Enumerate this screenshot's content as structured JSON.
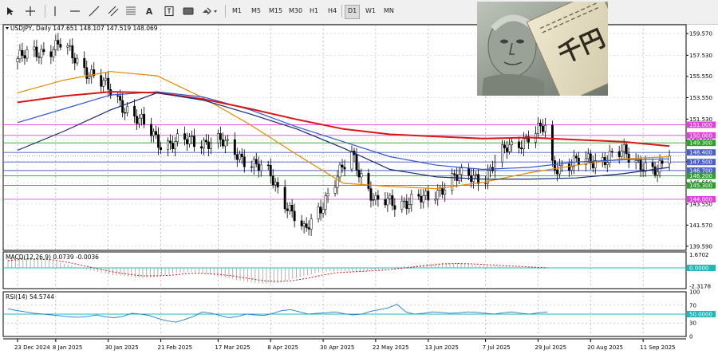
{
  "toolbar": {
    "tools": [
      "cursor-icon",
      "crosshair-icon",
      "vertical-line-icon",
      "horizontal-line-icon",
      "trendline-icon",
      "channel-icon",
      "fibonacci-icon",
      "text-icon",
      "label-icon",
      "rectangle-icon",
      "arrows-icon"
    ],
    "timeframes": [
      "M1",
      "M5",
      "M15",
      "M30",
      "H1",
      "H4",
      "D1",
      "W1",
      "MN"
    ],
    "active_timeframe": "D1"
  },
  "chart_data": [
    {
      "type": "candlestick",
      "title": "USDJPY, Daily  147.651 148.107 147.519 148.069",
      "symbol": "USDJPY",
      "period": "Daily",
      "last_ohlc": {
        "open": 147.651,
        "high": 148.107,
        "low": 147.519,
        "close": 148.069
      },
      "ylim": [
        139.2,
        160.4
      ],
      "y_ticks": [
        "159.570",
        "157.530",
        "155.550",
        "153.550",
        "151.530",
        "149.550",
        "147.550",
        "145.550",
        "143.550",
        "141.570",
        "139.590"
      ],
      "x_ticks": [
        "23 Dec 2024",
        "8 Jan 2025",
        "30 Jan 2025",
        "21 Feb 2025",
        "17 Mar 2025",
        "8 Apr 2025",
        "30 Apr 2025",
        "22 May 2025",
        "13 Jun 2025",
        "7 Jul 2025",
        "29 Jul 2025",
        "20 Aug 2025",
        "11 Sep 2025"
      ],
      "key_closes": [
        {
          "date": "2024-12-23",
          "close": 157.2
        },
        {
          "date": "2025-01-10",
          "close": 158.5
        },
        {
          "date": "2025-01-30",
          "close": 154.3
        },
        {
          "date": "2025-02-21",
          "close": 149.3
        },
        {
          "date": "2025-03-17",
          "close": 149.5
        },
        {
          "date": "2025-04-08",
          "close": 146.2
        },
        {
          "date": "2025-04-22",
          "close": 140.8
        },
        {
          "date": "2025-05-12",
          "close": 148.2
        },
        {
          "date": "2025-05-22",
          "close": 143.6
        },
        {
          "date": "2025-06-13",
          "close": 144.0
        },
        {
          "date": "2025-06-23",
          "close": 146.0
        },
        {
          "date": "2025-07-07",
          "close": 146.2
        },
        {
          "date": "2025-07-16",
          "close": 148.8
        },
        {
          "date": "2025-08-01",
          "close": 150.7
        },
        {
          "date": "2025-08-04",
          "close": 147.1
        },
        {
          "date": "2025-08-20",
          "close": 147.6
        },
        {
          "date": "2025-09-03",
          "close": 148.3
        },
        {
          "date": "2025-09-11",
          "close": 147.3
        },
        {
          "date": "2025-09-17",
          "close": 146.4
        },
        {
          "date": "2025-09-22",
          "close": 148.069
        }
      ],
      "moving_averages": [
        {
          "color": "#e08a00",
          "values": [
            154.0,
            155.2,
            156.0,
            155.6,
            153.5,
            151.0,
            148.2,
            145.5,
            145.2,
            145.0,
            145.6,
            146.5,
            147.2,
            147.8,
            148.0
          ]
        },
        {
          "color": "#3356cc",
          "values": [
            151.2,
            152.5,
            153.8,
            154.1,
            153.6,
            152.4,
            150.8,
            149.4,
            148.0,
            147.2,
            146.8,
            147.0,
            147.5,
            147.7,
            147.8
          ]
        },
        {
          "color": "#d81818",
          "values": [
            153.1,
            153.7,
            154.1,
            154.0,
            153.4,
            152.5,
            151.5,
            150.6,
            150.1,
            149.9,
            149.7,
            149.8,
            149.6,
            149.4,
            149.0
          ]
        },
        {
          "color": "#1a2a6e",
          "values": [
            148.6,
            150.4,
            152.4,
            154.0,
            153.3,
            152.0,
            150.6,
            148.8,
            146.8,
            146.1,
            145.9,
            145.9,
            146.0,
            146.4,
            147.0
          ]
        }
      ],
      "levels": [
        {
          "label": "151.000",
          "value": 151.0,
          "color": "#e040e0"
        },
        {
          "label": "150.000",
          "value": 150.0,
          "color": "#e040e0"
        },
        {
          "label": "149.300",
          "value": 149.3,
          "color": "#2e9e2e"
        },
        {
          "label": "148.400",
          "value": 148.4,
          "color": "#4a5fc8"
        },
        {
          "label": "147.500",
          "value": 147.5,
          "color": "#4a5fc8"
        },
        {
          "label": "146.700",
          "value": 146.7,
          "color": "#4a5fc8"
        },
        {
          "label": "146.200",
          "value": 146.2,
          "color": "#2e9e2e"
        },
        {
          "label": "145.300",
          "value": 145.3,
          "color": "#2e9e2e"
        },
        {
          "label": "144.000",
          "value": 144.0,
          "color": "#e040e0"
        }
      ]
    },
    {
      "type": "bar",
      "title": "MACD(12,26,9) 0.0739 -0.0036",
      "y_ticks": [
        "1.6702",
        "0.0000",
        "-2.3178"
      ],
      "ylim": [
        -2.6,
        2.0
      ],
      "hist_color": "#a9a9a9",
      "signal_color": "#d81818",
      "baseline_color": "#1fb8b8",
      "values": [
        1.1,
        1.2,
        1.1,
        0.9,
        0.4,
        -0.1,
        -0.5,
        -0.9,
        -1.1,
        -1.3,
        -1.1,
        -0.7,
        -0.5,
        -0.7,
        -1.0,
        -1.4,
        -1.8,
        -2.0,
        -1.9,
        -1.4,
        -0.9,
        -0.5,
        -0.4,
        -0.5,
        -0.4,
        -0.2,
        0.1,
        0.3,
        0.5,
        0.6,
        0.6,
        0.4,
        0.3,
        0.2,
        0.1,
        0.05,
        0.07
      ],
      "signal": [
        0.9,
        1.1,
        1.1,
        1.0,
        0.7,
        0.3,
        -0.1,
        -0.5,
        -0.8,
        -1.0,
        -1.0,
        -0.9,
        -0.7,
        -0.7,
        -0.8,
        -1.0,
        -1.3,
        -1.6,
        -1.7,
        -1.6,
        -1.3,
        -0.9,
        -0.6,
        -0.5,
        -0.4,
        -0.3,
        -0.1,
        0.1,
        0.3,
        0.5,
        0.55,
        0.5,
        0.4,
        0.3,
        0.2,
        0.1,
        0.0
      ]
    },
    {
      "type": "line",
      "title": "RSI(14) 54.5744",
      "y_ticks": [
        "100",
        "70",
        "50.0000",
        "30",
        "0"
      ],
      "ylim": [
        0,
        100
      ],
      "line_color": "#1e7fd0",
      "level_color": "#1fb8b8",
      "values": [
        62,
        58,
        55,
        52,
        50,
        48,
        46,
        44,
        43,
        45,
        48,
        44,
        42,
        45,
        52,
        50,
        47,
        40,
        35,
        32,
        38,
        45,
        55,
        52,
        47,
        42,
        45,
        50,
        48,
        47,
        52,
        58,
        60,
        55,
        50,
        52,
        53,
        55,
        51,
        48,
        50,
        56,
        60,
        64,
        72,
        55,
        50,
        52,
        55,
        54,
        52,
        53,
        55,
        54,
        52,
        50,
        53,
        55,
        52,
        50,
        53,
        54.57
      ]
    }
  ]
}
